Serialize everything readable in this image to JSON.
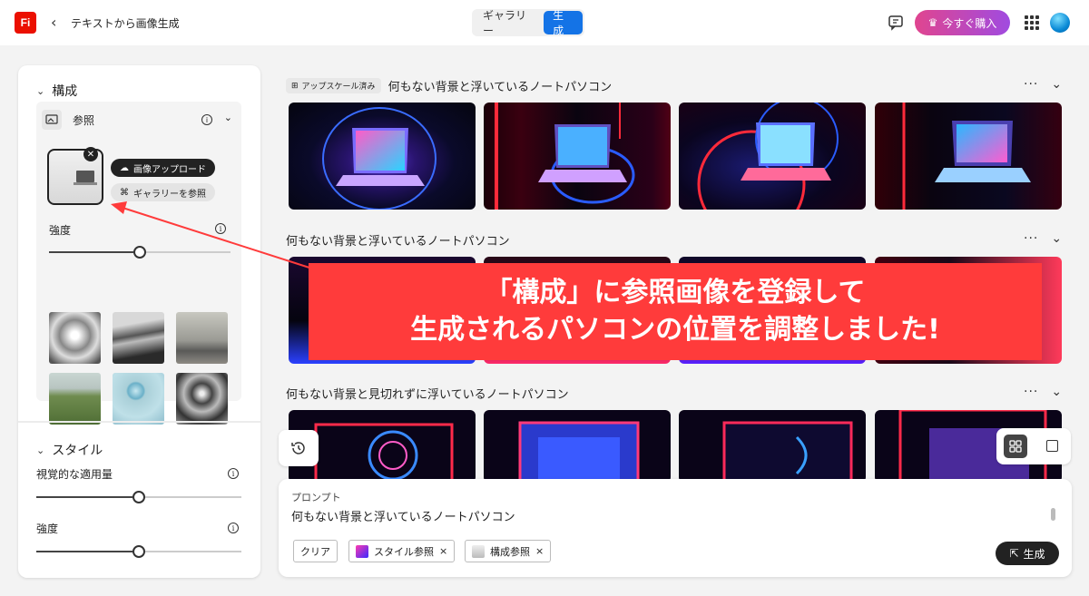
{
  "header": {
    "logo_text": "Fi",
    "back_icon": "chevron-left-icon",
    "title": "テキストから画像生成",
    "tabs": [
      {
        "label": "ギャラリー",
        "active": false
      },
      {
        "label": "生成",
        "active": true
      }
    ],
    "buy_label": "今すぐ購入",
    "accent": "#1473e6"
  },
  "panel": {
    "composition": {
      "title": "構成",
      "reference_label": "参照",
      "upload_label": "画像アップロード",
      "browse_label": "ギャラリーを参照",
      "strength_label": "強度",
      "strength_value": 0.5
    },
    "style": {
      "title": "スタイル",
      "visual_label": "視覚的な適用量",
      "visual_value": 0.5,
      "strength_label": "強度",
      "strength_value": 0.5
    }
  },
  "groups": [
    {
      "tag": "アップスケール済み",
      "title": "何もない背景と浮いているノートパソコン"
    },
    {
      "tag": "",
      "title": "何もない背景と浮いているノートパソコン"
    },
    {
      "tag": "",
      "title": "何もない背景と見切れずに浮いているノートパソコン"
    }
  ],
  "prompt": {
    "label": "プロンプト",
    "text": "何もない背景と浮いているノートパソコン",
    "clear_label": "クリア",
    "chips": [
      {
        "label": "スタイル参照",
        "close": "×"
      },
      {
        "label": "構成参照",
        "close": "×"
      }
    ],
    "generate_label": "生成"
  },
  "annotation": {
    "line1": "「構成」に参照画像を登録して",
    "line2": "生成されるパソコンの位置を調整しました!",
    "color": "#ff3b3b"
  }
}
